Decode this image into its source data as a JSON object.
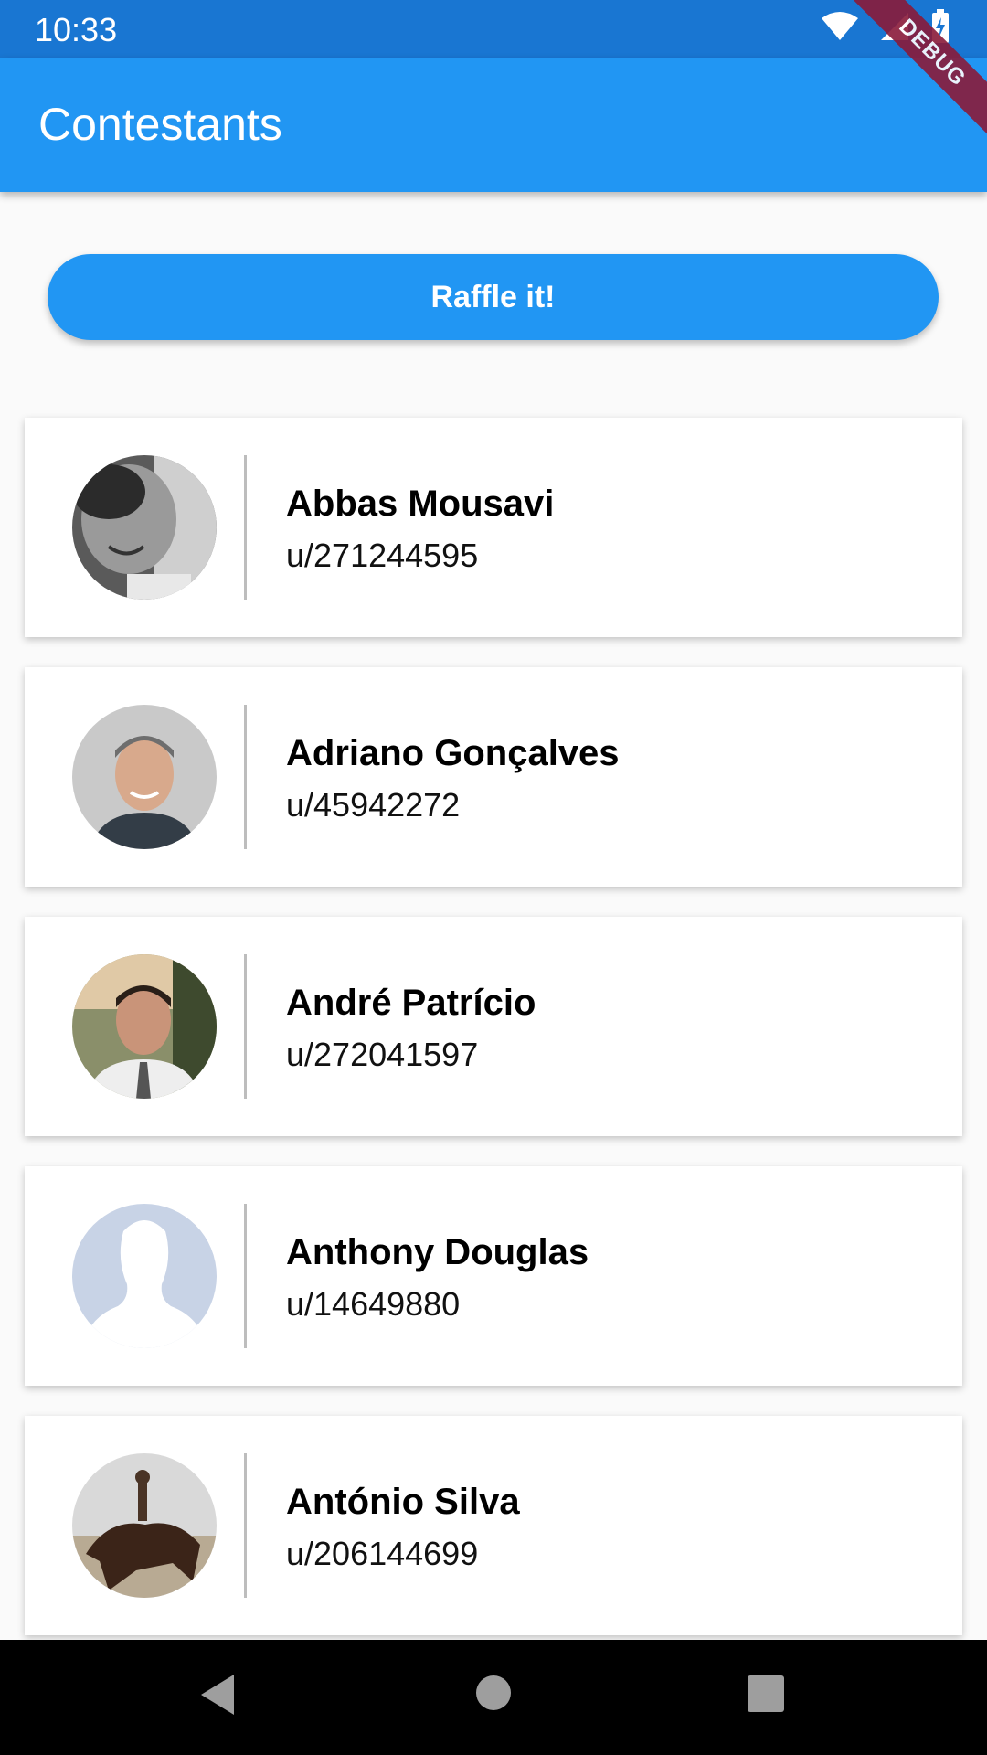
{
  "status_bar": {
    "time": "10:33",
    "icons": [
      "wifi-icon",
      "signal-icon",
      "battery-charging-icon"
    ]
  },
  "debug_banner": "DEBUG",
  "app_bar": {
    "title": "Contestants"
  },
  "raffle_button": {
    "label": "Raffle it!"
  },
  "contestants": [
    {
      "name": "Abbas Mousavi",
      "user": "u/271244595",
      "avatar": "photo-bw"
    },
    {
      "name": "Adriano Gonçalves",
      "user": "u/45942272",
      "avatar": "photo-man-gray-bg"
    },
    {
      "name": "André Patrício",
      "user": "u/272041597",
      "avatar": "photo-man-outdoor"
    },
    {
      "name": "Anthony Douglas",
      "user": "u/14649880",
      "avatar": "default-silhouette"
    },
    {
      "name": "António Silva",
      "user": "u/206144699",
      "avatar": "photo-horse-rider"
    }
  ],
  "colors": {
    "primary": "#2196F3",
    "status_bar": "#1976D2",
    "background": "#FAFAFA",
    "debug": "#8A1B3A"
  },
  "nav_bar": {
    "icons": [
      "back-icon",
      "home-icon",
      "recents-icon"
    ]
  }
}
